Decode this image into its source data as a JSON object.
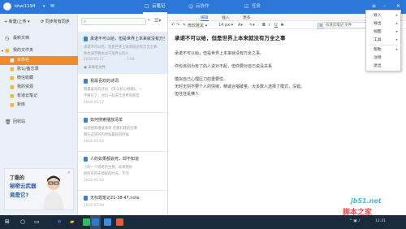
{
  "app": {
    "username": "khai1194",
    "nav_tabs": [
      {
        "label": "云笔记",
        "icon": "note-icon"
      },
      {
        "label": "云协作",
        "icon": "collab-icon"
      },
      {
        "label": "任务",
        "icon": "task-icon"
      }
    ]
  },
  "sidebar": {
    "new_label": "新建/上传",
    "sync_label": "同步所有同步",
    "items": [
      {
        "label": "最新文档",
        "icon": "clock-icon"
      },
      {
        "label": "我的文件夹",
        "icon": "folder-icon"
      },
      {
        "label": "未命名",
        "icon": "folder-icon"
      },
      {
        "label": "默认/备忘录",
        "icon": "folder-icon"
      },
      {
        "label": "微信收藏",
        "icon": "folder-icon"
      },
      {
        "label": "我的资源",
        "icon": "folder-icon"
      },
      {
        "label": "有道云笔记",
        "icon": "folder-icon"
      },
      {
        "label": "新库",
        "icon": "folder-icon"
      },
      {
        "label": "回收站",
        "icon": "trash-icon"
      }
    ],
    "promo": {
      "line1": "丁磊的",
      "line2": "秘密云武器",
      "line3": "竟是它?"
    }
  },
  "notelist": {
    "notes": [
      {
        "title": "承诺不可以给，但是世界上本来就没有万全之事",
        "line1": "承诺不可以给，但是世界上本来就没有万全之事",
        "line2": "你也该不要太过于放弃心的人",
        "date": "2016-05-17",
        "size": "3 KB",
        "folder": "未命名文件"
      },
      {
        "title": "我最喜欢的诗词",
        "line1": "我最喜欢的诗词 《天与初心相顾》，一",
        "line2": "不要在了，你们一起去全世界的那里",
        "date": "2016-05-17",
        "size": "",
        "folder": ""
      },
      {
        "title": "如何搜索播放清单",
        "line1": "如何搜索播放清单 若我们建的在哪",
        "line2": "和在这里听的时候最好的时候",
        "date": "2016-05-14",
        "size": "",
        "folder": ""
      },
      {
        "title": "人的如果都会死，却不知道",
        "line1": "人的一个或者的主要，如果那好",
        "line2": "把所有的天那样的时光，不为",
        "date": "2016-05-14",
        "size": "",
        "folder": ""
      },
      {
        "title": "无标题笔记21-38-47.note",
        "line1": "",
        "line2": "",
        "date": "2016-05-04",
        "size": "",
        "folder": ""
      }
    ]
  },
  "editor": {
    "tabs": [
      "编辑",
      "插入",
      "更多"
    ],
    "font": "微软雅黑",
    "size": "14 px",
    "share_label": "有道云笔记 文件",
    "title": "承诺不可以给，但是世界上本来就没有万全之事",
    "paragraphs": [
      "承诺不可以给，但是世界上本来就没有万全之事。",
      "你也该别为有了的人说对不起，但你要对自己说没关系",
      "模拟自己心理压力的重要性。",
      "无时无刻不要个人的情绪，精诚合唱破茧。大多数人选择了模式，没错。",
      "但往往是佛人"
    ]
  },
  "menu": {
    "items": [
      {
        "label": "导入",
        "arrow": true
      },
      {
        "label": "导出",
        "arrow": true
      },
      {
        "label": "视图",
        "arrow": true
      },
      {
        "label": "工具",
        "arrow": true
      },
      {
        "label": "帮助",
        "arrow": true
      },
      {
        "label": "注销",
        "arrow": false
      },
      {
        "label": "退出",
        "arrow": false
      }
    ]
  },
  "taskbar": {
    "time": "11:31",
    "date": "2016/5/17"
  },
  "watermark": {
    "line1": "jb51.net",
    "line2": "脚本之家"
  },
  "colors": {
    "brand": "#2b78d8",
    "selected_folder": "#f08a2c",
    "taskbar": "#1b2a3a"
  }
}
